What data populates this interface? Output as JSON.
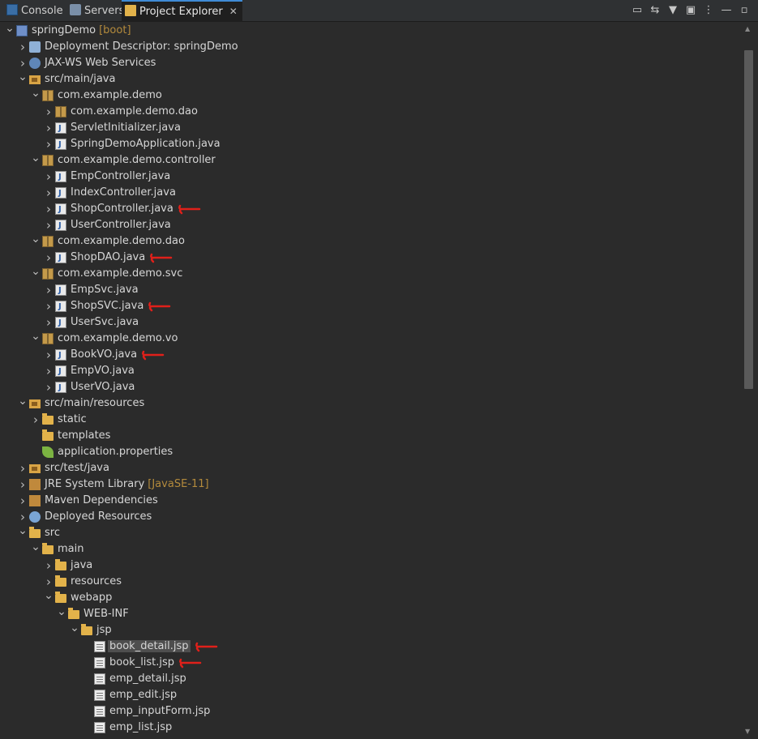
{
  "tabs": [
    {
      "label": "Console",
      "icon": "console-icon"
    },
    {
      "label": "Servers",
      "icon": "servers-icon"
    },
    {
      "label": "Project Explorer",
      "icon": "project-explorer-icon",
      "active": true
    }
  ],
  "toolbar": [
    {
      "name": "collapse-all-icon",
      "glyph": "▭"
    },
    {
      "name": "link-with-editor-icon",
      "glyph": "⇆"
    },
    {
      "name": "filter-icon",
      "glyph": "▼"
    },
    {
      "name": "select-working-set-icon",
      "glyph": "▣"
    },
    {
      "name": "view-menu-icon",
      "glyph": "⋮"
    },
    {
      "name": "minimize-icon",
      "glyph": "—"
    },
    {
      "name": "maximize-icon",
      "glyph": "▫"
    }
  ],
  "tree": [
    {
      "label": "springDemo",
      "decoration": "[boot]",
      "level": 0,
      "state": "open",
      "icon": "project"
    },
    {
      "label": "Deployment Descriptor: springDemo",
      "level": 1,
      "state": "closed",
      "icon": "desc"
    },
    {
      "label": "JAX-WS Web Services",
      "level": 1,
      "state": "closed",
      "icon": "ws"
    },
    {
      "label": "src/main/java",
      "level": 1,
      "state": "open",
      "icon": "srcf"
    },
    {
      "label": "com.example.demo",
      "level": 2,
      "state": "open",
      "icon": "pkg"
    },
    {
      "label": "com.example.demo.dao",
      "level": 3,
      "state": "closed",
      "icon": "pkg"
    },
    {
      "label": "ServletInitializer.java",
      "level": 3,
      "state": "closed",
      "icon": "java"
    },
    {
      "label": "SpringDemoApplication.java",
      "level": 3,
      "state": "closed",
      "icon": "java"
    },
    {
      "label": "com.example.demo.controller",
      "level": 2,
      "state": "open",
      "icon": "pkg"
    },
    {
      "label": "EmpController.java",
      "level": 3,
      "state": "closed",
      "icon": "java"
    },
    {
      "label": "IndexController.java",
      "level": 3,
      "state": "closed",
      "icon": "java"
    },
    {
      "label": "ShopController.java",
      "level": 3,
      "state": "closed",
      "icon": "java",
      "marked": true
    },
    {
      "label": "UserController.java",
      "level": 3,
      "state": "closed",
      "icon": "java"
    },
    {
      "label": "com.example.demo.dao",
      "level": 2,
      "state": "open",
      "icon": "pkg"
    },
    {
      "label": "ShopDAO.java",
      "level": 3,
      "state": "closed",
      "icon": "java",
      "marked": true
    },
    {
      "label": "com.example.demo.svc",
      "level": 2,
      "state": "open",
      "icon": "pkg"
    },
    {
      "label": "EmpSvc.java",
      "level": 3,
      "state": "closed",
      "icon": "java"
    },
    {
      "label": "ShopSVC.java",
      "level": 3,
      "state": "closed",
      "icon": "java",
      "marked": true
    },
    {
      "label": "UserSvc.java",
      "level": 3,
      "state": "closed",
      "icon": "java"
    },
    {
      "label": "com.example.demo.vo",
      "level": 2,
      "state": "open",
      "icon": "pkg"
    },
    {
      "label": "BookVO.java",
      "level": 3,
      "state": "closed",
      "icon": "java",
      "marked": true
    },
    {
      "label": "EmpVO.java",
      "level": 3,
      "state": "closed",
      "icon": "java"
    },
    {
      "label": "UserVO.java",
      "level": 3,
      "state": "closed",
      "icon": "java"
    },
    {
      "label": "src/main/resources",
      "level": 1,
      "state": "open",
      "icon": "srcf"
    },
    {
      "label": "static",
      "level": 2,
      "state": "closed",
      "icon": "folder"
    },
    {
      "label": "templates",
      "level": 2,
      "state": "none",
      "icon": "folder"
    },
    {
      "label": "application.properties",
      "level": 2,
      "state": "none",
      "icon": "leaf"
    },
    {
      "label": "src/test/java",
      "level": 1,
      "state": "closed",
      "icon": "srcf"
    },
    {
      "label": "JRE System Library",
      "decoration": "[JavaSE-11]",
      "level": 1,
      "state": "closed",
      "icon": "lib"
    },
    {
      "label": "Maven Dependencies",
      "level": 1,
      "state": "closed",
      "icon": "lib"
    },
    {
      "label": "Deployed Resources",
      "level": 1,
      "state": "closed",
      "icon": "res"
    },
    {
      "label": "src",
      "level": 1,
      "state": "open",
      "icon": "folder"
    },
    {
      "label": "main",
      "level": 2,
      "state": "open",
      "icon": "folder"
    },
    {
      "label": "java",
      "level": 3,
      "state": "closed",
      "icon": "folder"
    },
    {
      "label": "resources",
      "level": 3,
      "state": "closed",
      "icon": "folder"
    },
    {
      "label": "webapp",
      "level": 3,
      "state": "open",
      "icon": "folder"
    },
    {
      "label": "WEB-INF",
      "level": 4,
      "state": "open",
      "icon": "folder"
    },
    {
      "label": "jsp",
      "level": 5,
      "state": "open",
      "icon": "folder"
    },
    {
      "label": "book_detail.jsp",
      "level": 6,
      "state": "none",
      "icon": "jsp",
      "selected": true,
      "marked": true
    },
    {
      "label": "book_list.jsp",
      "level": 6,
      "state": "none",
      "icon": "jsp",
      "marked": true
    },
    {
      "label": "emp_detail.jsp",
      "level": 6,
      "state": "none",
      "icon": "jsp"
    },
    {
      "label": "emp_edit.jsp",
      "level": 6,
      "state": "none",
      "icon": "jsp"
    },
    {
      "label": "emp_inputForm.jsp",
      "level": 6,
      "state": "none",
      "icon": "jsp"
    },
    {
      "label": "emp_list.jsp",
      "level": 6,
      "state": "none",
      "icon": "jsp"
    }
  ],
  "scrollbar": {
    "up": "▲",
    "down": "▼"
  }
}
